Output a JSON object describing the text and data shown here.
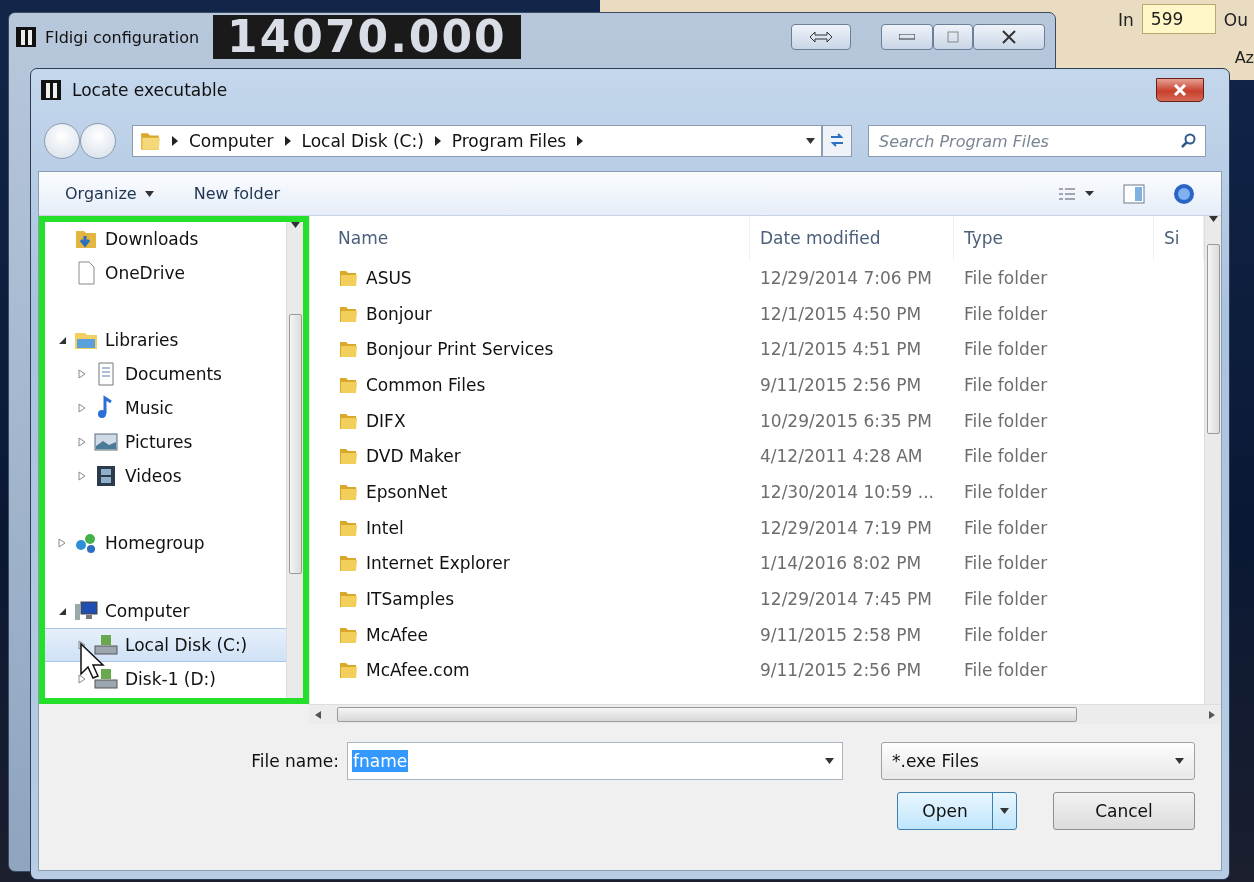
{
  "background_app": {
    "frequency": "14070.000",
    "in_label": "In",
    "in_value": "599",
    "cut_label_1": "Ou",
    "cut_label_2": "Az"
  },
  "config_window": {
    "title": "Fldigi configuration"
  },
  "dialog": {
    "title": "Locate executable",
    "breadcrumb": [
      "Computer",
      "Local Disk (C:)",
      "Program Files"
    ],
    "search": {
      "placeholder": "Search Program Files"
    },
    "toolbar": [
      {
        "label": "Organize",
        "kind": "menu"
      },
      {
        "label": "New folder",
        "kind": "button"
      }
    ],
    "nav_sections": [
      {
        "items": [
          {
            "label": "Downloads",
            "kind": "downloads",
            "selected": false
          },
          {
            "label": "OneDrive",
            "kind": "document",
            "selected": false
          }
        ]
      },
      {
        "items": [
          {
            "label": "Libraries",
            "kind": "library",
            "selected": false,
            "expanded": true,
            "children": [
              {
                "label": "Documents",
                "kind": "documents",
                "selected": false,
                "expanded": false
              },
              {
                "label": "Music",
                "kind": "music",
                "selected": false,
                "expanded": false
              },
              {
                "label": "Pictures",
                "kind": "pictures",
                "selected": false,
                "expanded": false
              },
              {
                "label": "Videos",
                "kind": "videos",
                "selected": false,
                "expanded": false
              }
            ]
          }
        ]
      },
      {
        "items": [
          {
            "label": "Homegroup",
            "kind": "homegroup",
            "selected": false,
            "expanded": false
          }
        ]
      },
      {
        "items": [
          {
            "label": "Computer",
            "kind": "computer",
            "selected": false,
            "expanded": true,
            "children": [
              {
                "label": "Local Disk (C:)",
                "kind": "drive",
                "selected": true,
                "expanded": false
              },
              {
                "label": "Disk-1 (D:)",
                "kind": "drive",
                "selected": false,
                "expanded": false
              }
            ]
          }
        ]
      }
    ],
    "columns": [
      "Name",
      "Date modified",
      "Type",
      "Si"
    ],
    "rows": [
      {
        "name": "ASUS",
        "date": "12/29/2014 7:06 PM",
        "type": "File folder"
      },
      {
        "name": "Bonjour",
        "date": "12/1/2015 4:50 PM",
        "type": "File folder"
      },
      {
        "name": "Bonjour Print Services",
        "date": "12/1/2015 4:51 PM",
        "type": "File folder"
      },
      {
        "name": "Common Files",
        "date": "9/11/2015 2:56 PM",
        "type": "File folder"
      },
      {
        "name": "DIFX",
        "date": "10/29/2015 6:35 PM",
        "type": "File folder"
      },
      {
        "name": "DVD Maker",
        "date": "4/12/2011 4:28 AM",
        "type": "File folder"
      },
      {
        "name": "EpsonNet",
        "date": "12/30/2014 10:59 ...",
        "type": "File folder"
      },
      {
        "name": "Intel",
        "date": "12/29/2014 7:19 PM",
        "type": "File folder"
      },
      {
        "name": "Internet Explorer",
        "date": "1/14/2016 8:02 PM",
        "type": "File folder"
      },
      {
        "name": "ITSamples",
        "date": "12/29/2014 7:45 PM",
        "type": "File folder"
      },
      {
        "name": "McAfee",
        "date": "9/11/2015 2:58 PM",
        "type": "File folder"
      },
      {
        "name": "McAfee.com",
        "date": "9/11/2015 2:56 PM",
        "type": "File folder"
      }
    ],
    "file_name": {
      "label": "File name:",
      "value": "fname"
    },
    "file_type": {
      "value": "*.exe Files"
    },
    "buttons": [
      {
        "label": "Open",
        "kind": "split"
      },
      {
        "label": "Cancel",
        "kind": "plain"
      }
    ]
  }
}
